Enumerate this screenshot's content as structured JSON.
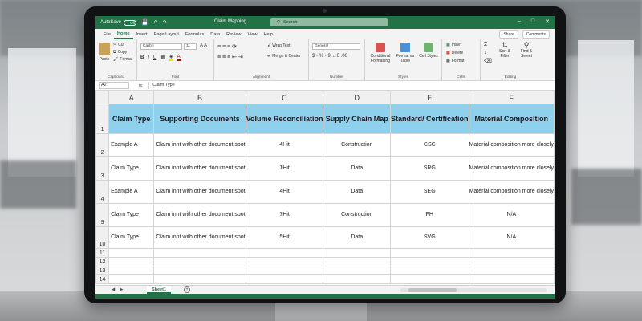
{
  "titlebar": {
    "autosave_label": "AutoSave",
    "autosave_state": "Off",
    "doc_title": "Claim Mapping",
    "search_placeholder": "Search"
  },
  "menu": {
    "tabs": [
      "File",
      "Home",
      "Insert",
      "Page Layout",
      "Formulas",
      "Data",
      "Review",
      "View",
      "Help"
    ],
    "active_tab": "Home",
    "share_label": "Share",
    "comments_label": "Comments"
  },
  "ribbon": {
    "clipboard": {
      "paste": "Paste",
      "cut": "Cut",
      "copy": "Copy",
      "format": "Format",
      "label": "Clipboard"
    },
    "font": {
      "name": "Calibri",
      "size": "11",
      "label": "Font"
    },
    "alignment": {
      "wrap": "Wrap Text",
      "merge": "Merge & Center",
      "label": "Alignment"
    },
    "number": {
      "format": "General",
      "label": "Number"
    },
    "styles": {
      "conditional": "Conditional Formatting",
      "format_table": "Format as Table",
      "cell_styles": "Cell Styles",
      "label": "Styles"
    },
    "cells": {
      "insert": "Insert",
      "delete": "Delete",
      "format": "Format",
      "label": "Cells"
    },
    "editing": {
      "sort": "Sort & Filter",
      "find": "Find & Select",
      "label": "Editing"
    }
  },
  "formula_bar": {
    "cell_ref": "A2",
    "fx": "fx",
    "content": "Claim Type"
  },
  "sheet": {
    "columns": [
      "A",
      "B",
      "C",
      "D",
      "E",
      "F"
    ],
    "header_row_number": "1",
    "headers": [
      "Claim Type",
      "Supporting Documents",
      "Volume Reconciliation",
      "Supply Chain Map",
      "Standard/ Certification",
      "Material Composition"
    ],
    "rows": [
      {
        "num": "2",
        "cells": [
          "Example A",
          "Claim innt with other document spot",
          "4Hit",
          "Construction",
          "CSC",
          "Material composition more closely"
        ]
      },
      {
        "num": "3",
        "cells": [
          "Claim Type",
          "Claim innt with other document spot",
          "1Hit",
          "Data",
          "SRG",
          "Material composition more closely"
        ]
      },
      {
        "num": "4",
        "cells": [
          "Example A",
          "Claim innt with other document spot",
          "4Hit",
          "Data",
          "SEG",
          "Material composition more closely"
        ]
      },
      {
        "num": "9",
        "cells": [
          "Claim Type",
          "Claim innt with other document spot",
          "7Hit",
          "Construction",
          "FH",
          "N/A"
        ]
      },
      {
        "num": "10",
        "cells": [
          "Claim Type",
          "Claim innt with other document spot",
          "5Hit",
          "Data",
          "SVG",
          "N/A"
        ]
      }
    ],
    "empty_rows": [
      "11",
      "12",
      "13",
      "14"
    ]
  },
  "sheet_tabs": {
    "active": "Sheet1",
    "add": "+"
  },
  "colors": {
    "excel_green": "#217346",
    "header_fill": "#8fd0ec"
  }
}
